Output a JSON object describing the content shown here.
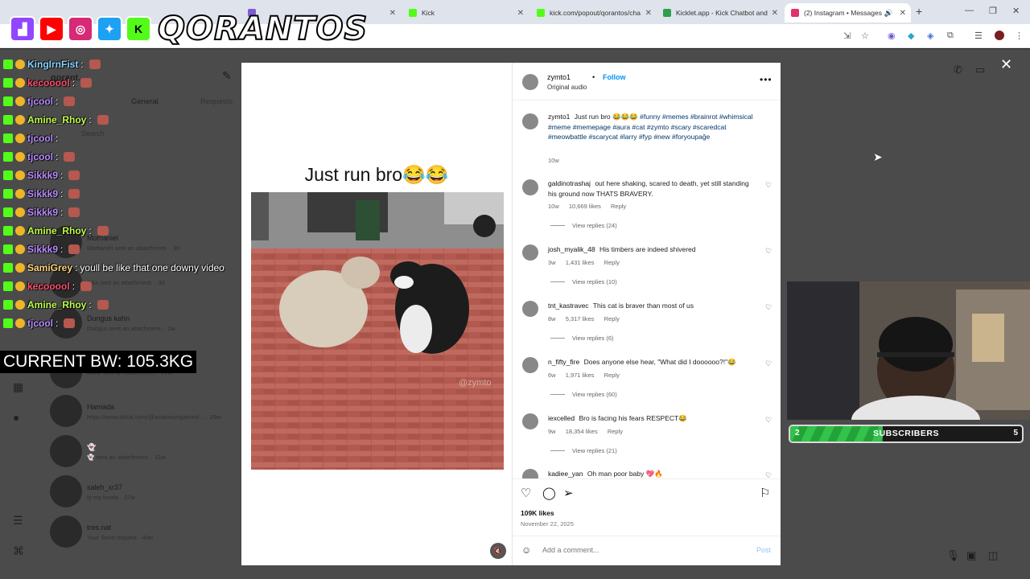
{
  "browser": {
    "tabs": [
      {
        "label": "",
        "color": "#7c5cd1"
      },
      {
        "label": "Kick",
        "color": "#53fc18"
      },
      {
        "label": "kick.com/popout/qorantos/cha",
        "color": "#53fc18"
      },
      {
        "label": "Kicklet.app - Kick Chatbot and",
        "color": "#2e9e4f"
      },
      {
        "label": "(2) Instagram • Messages",
        "color": "#e1306c"
      }
    ],
    "new_tab_glyph": "+"
  },
  "instagram_bg": {
    "inbox_title": "qorant...",
    "tab_general": "General",
    "tab_requests": "Requests",
    "search_placeholder": "Search",
    "threads": [
      {
        "name": "Mothaniel",
        "sub": "Mothaniel sent an attachment. · 3h"
      },
      {
        "name": "",
        "sub": "Jala sent an attachment. · 3d"
      },
      {
        "name": "Dungus kahn",
        "sub": "Dungus sent an attachment. · 2w"
      },
      {
        "name": "",
        "sub": "Nonk sent an attachment. · 27w"
      },
      {
        "name": "Hamada",
        "sub": "https://www.tiktok.com/@asianwyngames/... · 29w"
      },
      {
        "name": "👻",
        "sub": "👻 sent an attachment. · 31w"
      },
      {
        "name": "saleh_xr37",
        "sub": "fy my broda · 37w"
      },
      {
        "name": "tres.nat",
        "sub": "Your Send request · 40w"
      }
    ]
  },
  "post": {
    "caption_title": "Just run bro😂😂",
    "watermark": "@zymto",
    "author": "zymto1",
    "follow_label": "Follow",
    "audio": "Original audio",
    "caption": {
      "user": "zymto1",
      "text": "Just run bro 😂😂😂",
      "tags": "#funny #memes #brainrot #whimsical #meme #memepage #aura #cat #zymto #scary #scaredcat #meowbattle #scarycat #larry #fyp #new #foryoupağe",
      "time": "10w"
    },
    "comments": [
      {
        "user": "galdinotrashaj",
        "text": "out here shaking, scared to death, yet still standing his ground now THATS BRAVERY.",
        "time": "10w",
        "likes": "10,669 likes",
        "reply": "Reply",
        "view_replies": "View replies (24)"
      },
      {
        "user": "josh_myalik_48",
        "text": "His timbers are indeed shivered",
        "time": "3w",
        "likes": "1,431 likes",
        "reply": "Reply",
        "view_replies": "View replies (10)"
      },
      {
        "user": "tnt_kastravec",
        "text": "This cat is braver than most of us",
        "time": "8w",
        "likes": "5,317 likes",
        "reply": "Reply",
        "view_replies": "View replies (6)"
      },
      {
        "user": "n_fifty_fire",
        "text": "Does anyone else hear, \"What did I doooooo?!\"😂",
        "time": "6w",
        "likes": "1,971 likes",
        "reply": "Reply",
        "view_replies": "View replies (60)"
      },
      {
        "user": "iexcelled",
        "text": "Bro is facing his fears RESPECT😂",
        "time": "9w",
        "likes": "18,354 likes",
        "reply": "Reply",
        "view_replies": "View replies (21)"
      },
      {
        "user": "kadiee_yan",
        "text": "Oh man poor baby 💖🔥",
        "time": "",
        "likes": "",
        "reply": "",
        "view_replies": ""
      }
    ],
    "likes_count": "109K likes",
    "date": "November 22, 2025",
    "comment_placeholder": "Add a comment...",
    "post_label": "Post"
  },
  "stream": {
    "logo_text": "QORANTOS",
    "chat": [
      {
        "user": "KingIrnFist",
        "msg": "",
        "color": "#8ad4ff",
        "emote": true
      },
      {
        "user": "kecooool",
        "msg": "",
        "color": "#ff4d6d",
        "emote": true
      },
      {
        "user": "tjcool",
        "msg": "",
        "color": "#b98cff",
        "emote": true
      },
      {
        "user": "Amine_Rhoy",
        "msg": "",
        "color": "#bfff4a",
        "emote": true
      },
      {
        "user": "tjcool",
        "msg": "",
        "color": "#b98cff",
        "emote": false
      },
      {
        "user": "tjcool",
        "msg": "",
        "color": "#b98cff",
        "emote": true
      },
      {
        "user": "Sikkk9",
        "msg": "",
        "color": "#b98cff",
        "emote": true
      },
      {
        "user": "Sikkk9",
        "msg": "",
        "color": "#b98cff",
        "emote": true
      },
      {
        "user": "Sikkk9",
        "msg": "",
        "color": "#b98cff",
        "emote": true
      },
      {
        "user": "Amine_Rhoy",
        "msg": "",
        "color": "#bfff4a",
        "emote": true
      },
      {
        "user": "Sikkk9",
        "msg": "",
        "color": "#b98cff",
        "emote": true
      },
      {
        "user": "SamiGrey",
        "msg": "youll be like that one downy video",
        "color": "#ffd27a",
        "emote": false
      },
      {
        "user": "kecooool",
        "msg": "",
        "color": "#ff4d6d",
        "emote": true
      },
      {
        "user": "Amine_Rhoy",
        "msg": "",
        "color": "#bfff4a",
        "emote": true
      },
      {
        "user": "tjcool",
        "msg": "",
        "color": "#b98cff",
        "emote": true
      }
    ],
    "bw_label": "CURRENT BW: 105.3KG",
    "sub_goal": {
      "label": "SUBSCRIBERS",
      "current": "2",
      "target": "5",
      "progress": 0.4
    }
  }
}
